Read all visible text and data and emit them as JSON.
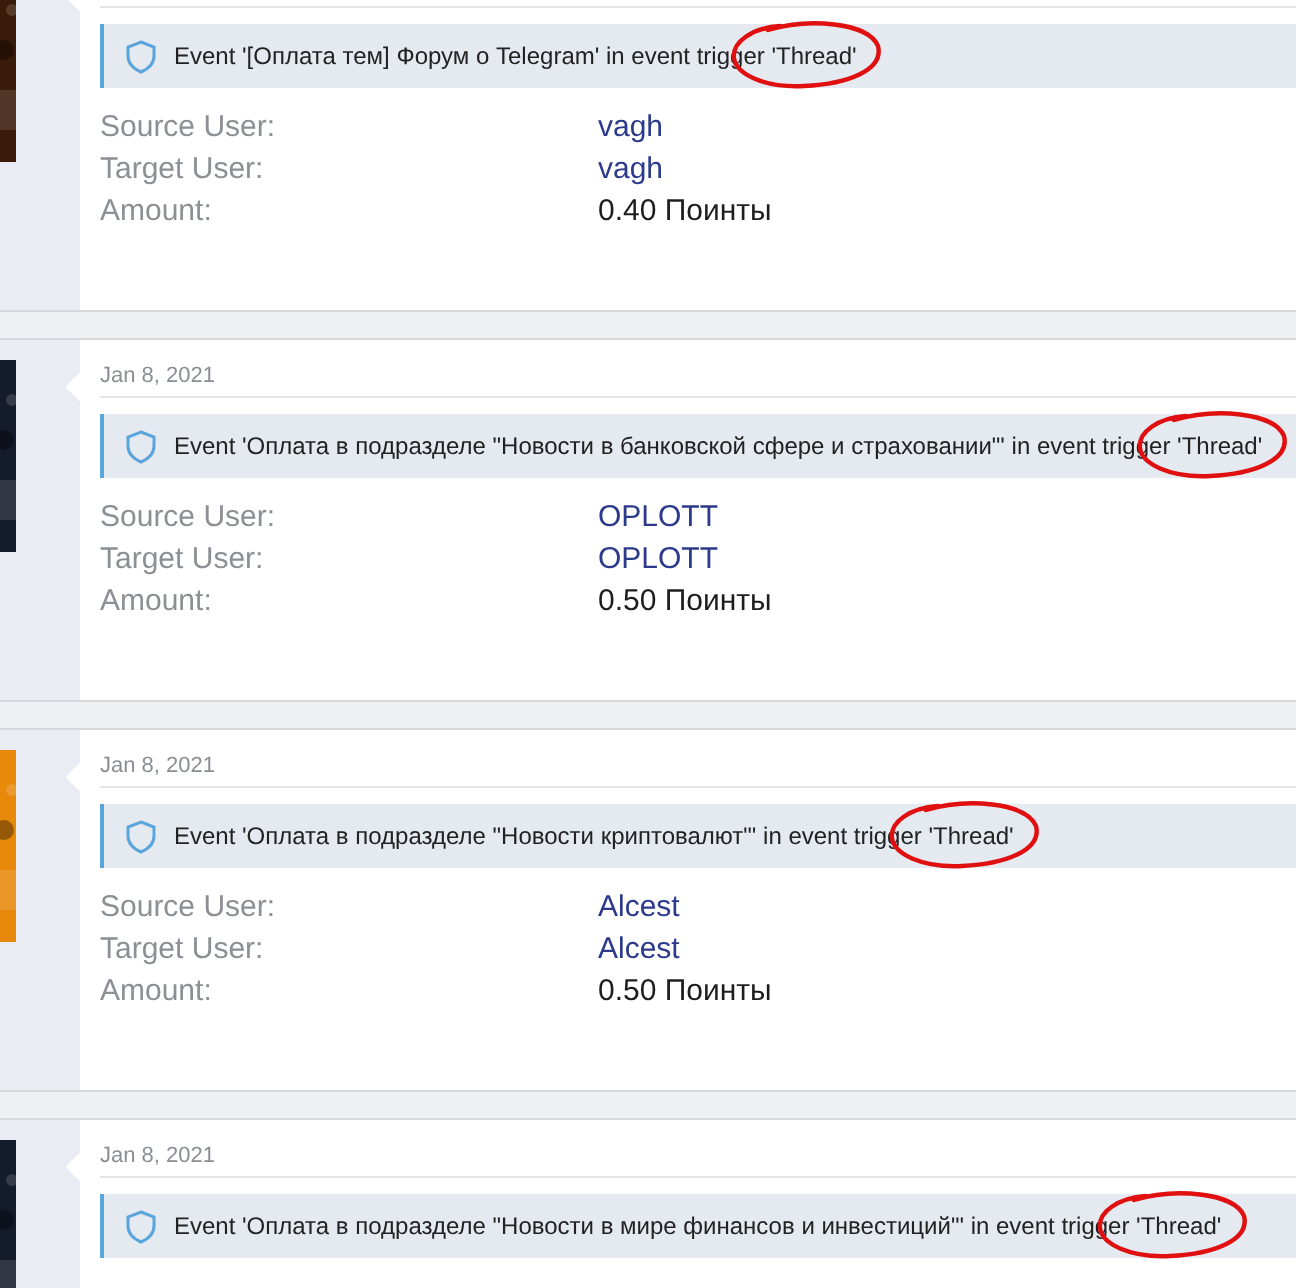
{
  "entries": [
    {
      "event": "Event '[Оплата тем] Форум о Telegram' in event trigger 'Thread'",
      "circled": true,
      "fields": [
        {
          "label": "Source User:",
          "value": "vagh",
          "kind": "link"
        },
        {
          "label": "Target User:",
          "value": "vagh",
          "kind": "link"
        },
        {
          "label": "Amount:",
          "value": "0.40 Поинты",
          "kind": "plain"
        }
      ]
    },
    {
      "date": "Jan 8, 2021",
      "event": "Event 'Оплата в подразделе \"Новости в банковской сфере и страховании\"' in event trigger 'Thread'",
      "circled": true,
      "fields": [
        {
          "label": "Source User:",
          "value": "OPLOTT",
          "kind": "link"
        },
        {
          "label": "Target User:",
          "value": "OPLOTT",
          "kind": "link"
        },
        {
          "label": "Amount:",
          "value": "0.50 Поинты",
          "kind": "plain"
        }
      ]
    },
    {
      "date": "Jan 8, 2021",
      "event": "Event 'Оплата в подразделе \"Новости криптовалют\"' in event trigger 'Thread'",
      "circled": true,
      "fields": [
        {
          "label": "Source User:",
          "value": "Alcest",
          "kind": "link"
        },
        {
          "label": "Target User:",
          "value": "Alcest",
          "kind": "link"
        },
        {
          "label": "Amount:",
          "value": "0.50 Поинты",
          "kind": "plain"
        }
      ]
    },
    {
      "date": "Jan 8, 2021",
      "event": "Event 'Оплата в подразделе \"Новости в мире финансов и инвестиций\"' in event trigger 'Thread'",
      "circled": true
    }
  ]
}
